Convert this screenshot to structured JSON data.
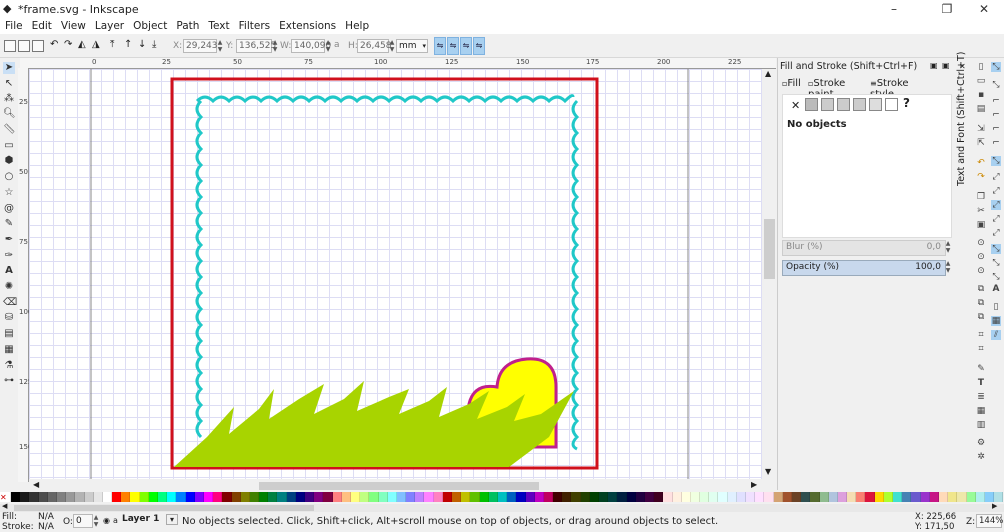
{
  "window": {
    "title": "*frame.svg - Inkscape",
    "controls": {
      "minimize": "–",
      "maximize": "❐",
      "close": "✕"
    }
  },
  "menu": [
    "File",
    "Edit",
    "View",
    "Layer",
    "Object",
    "Path",
    "Text",
    "Filters",
    "Extensions",
    "Help"
  ],
  "toolbar": {
    "x_label": "X:",
    "x_value": "29,243",
    "y_label": "Y:",
    "y_value": "136,525",
    "w_label": "W:",
    "w_value": "140,090",
    "lock_icon": "a",
    "h_label": "H:",
    "h_value": "26,458",
    "unit": "mm"
  },
  "ruler": {
    "h_labels": [
      "0",
      "25",
      "50",
      "75",
      "100",
      "125",
      "150",
      "175",
      "200",
      "225"
    ],
    "v_labels": [
      "25",
      "50",
      "75",
      "100",
      "125",
      "150"
    ]
  },
  "fill_stroke": {
    "title": "Fill and Stroke (Shift+Ctrl+F)",
    "tab_fill": "Fill",
    "tab_stroke_paint": "Stroke paint",
    "tab_stroke_style": "Stroke style",
    "no_objects": "No objects",
    "blur_label": "Blur (%)",
    "blur_value": "0,0",
    "opacity_label": "Opacity (%)",
    "opacity_value": "100,0"
  },
  "text_font_tab": "Text and Font (Shift+Ctrl+T)",
  "status": {
    "fill_label": "Fill:",
    "fill_value": "N/A",
    "stroke_label": "Stroke:",
    "stroke_value": "N/A",
    "o_label": "O:",
    "o_value": "0",
    "layer": "Layer 1",
    "message": "No objects selected. Click, Shift+click, Alt+scroll mouse on top of objects, or drag around objects to select.",
    "coord_x": "X: 225,66",
    "coord_y": "Y: 171,50",
    "zoom_label": "Z:",
    "zoom_value": "144%"
  },
  "colors": {
    "frame_border": "#d0101c",
    "wave": "#20c8c8",
    "grass": "#a8d400",
    "heart_fill": "#ffff00",
    "heart_stroke": "#c0208c",
    "accent": "#a8d0f0"
  },
  "palette": [
    "#000000",
    "#1a1a1a",
    "#333333",
    "#4d4d4d",
    "#666666",
    "#808080",
    "#999999",
    "#b3b3b3",
    "#cccccc",
    "#e6e6e6",
    "#ffffff",
    "#ff0000",
    "#ff8000",
    "#ffff00",
    "#80ff00",
    "#00ff00",
    "#00ff80",
    "#00ffff",
    "#0080ff",
    "#0000ff",
    "#8000ff",
    "#ff00ff",
    "#ff0080",
    "#800000",
    "#804000",
    "#808000",
    "#408000",
    "#008000",
    "#008040",
    "#008080",
    "#004080",
    "#000080",
    "#400080",
    "#800080",
    "#800040",
    "#ff8080",
    "#ffc080",
    "#ffff80",
    "#c0ff80",
    "#80ff80",
    "#80ffc0",
    "#80ffff",
    "#80c0ff",
    "#8080ff",
    "#c080ff",
    "#ff80ff",
    "#ff80c0",
    "#c00000",
    "#c06000",
    "#c0c000",
    "#60c000",
    "#00c000",
    "#00c060",
    "#00c0c0",
    "#0060c0",
    "#0000c0",
    "#6000c0",
    "#c000c0",
    "#c00060",
    "#400000",
    "#402000",
    "#404000",
    "#204000",
    "#004000",
    "#004020",
    "#004040",
    "#002040",
    "#000040",
    "#200040",
    "#400040",
    "#400020",
    "#ffe0e0",
    "#fff0e0",
    "#ffffe0",
    "#f0ffe0",
    "#e0ffe0",
    "#e0fff0",
    "#e0ffff",
    "#e0f0ff",
    "#e0e0ff",
    "#f0e0ff",
    "#ffe0ff",
    "#ffe0f0",
    "#d4a373",
    "#a0522d",
    "#6b4226",
    "#2f4f4f",
    "#556b2f",
    "#8fbc8f",
    "#b0c4de",
    "#dda0dd",
    "#f5deb3",
    "#fa8072",
    "#dc143c",
    "#ffd700",
    "#adff2f",
    "#40e0d0",
    "#4682b4",
    "#6a5acd",
    "#9932cc",
    "#c71585",
    "#ffdab9",
    "#f0e68c",
    "#eee8aa",
    "#98fb98",
    "#afeeee",
    "#87cefa",
    "#b0e0e6"
  ]
}
